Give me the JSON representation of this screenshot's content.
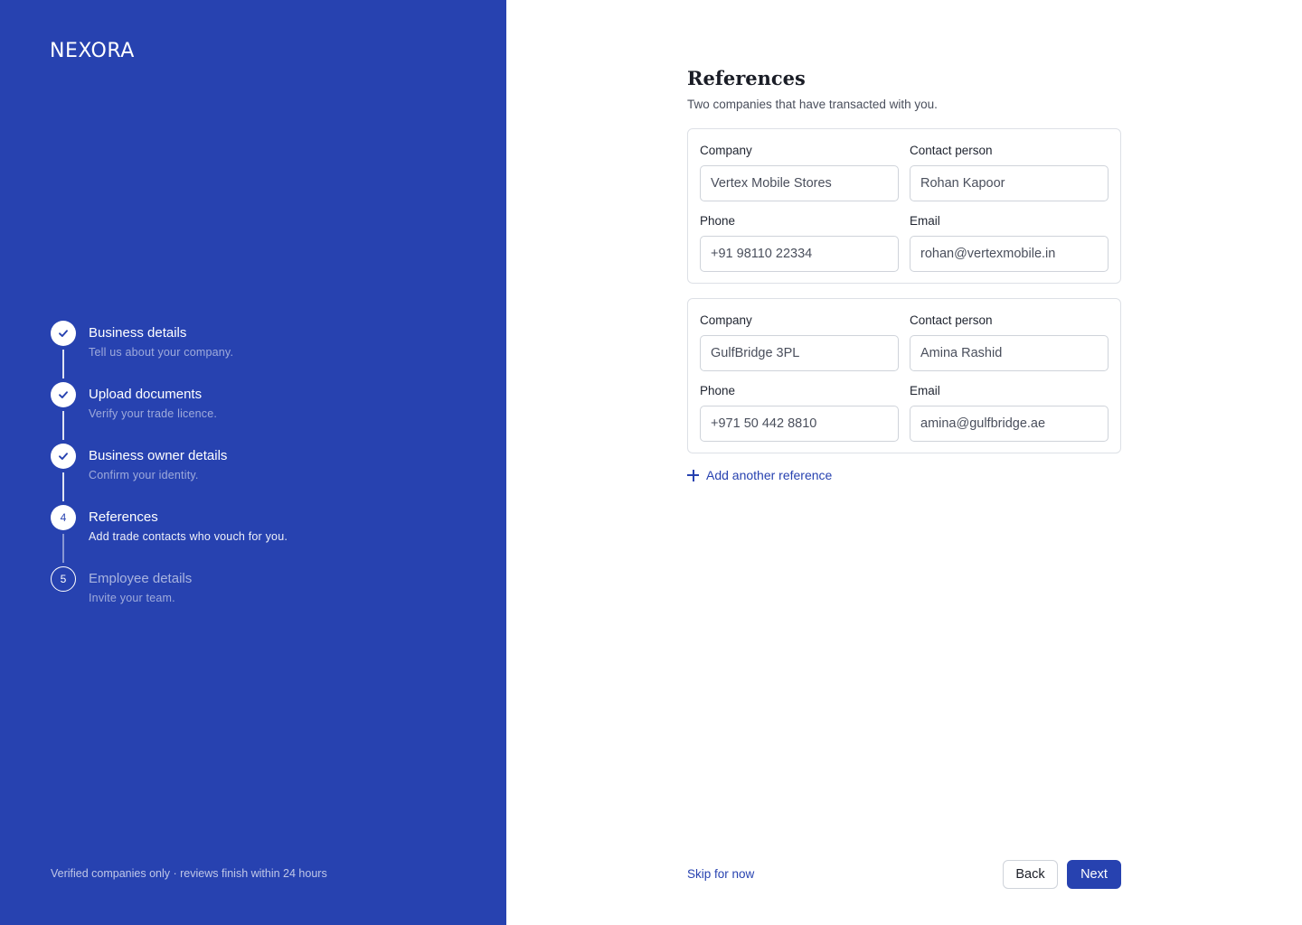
{
  "brand": {
    "logo": "NEXORA",
    "footer": "Verified companies only · reviews finish within 24 hours",
    "accent_color": "#2742b0"
  },
  "steps": [
    {
      "number": "1",
      "title": "Business details",
      "description": "Tell us about your company.",
      "status": "done",
      "icon": "check-icon"
    },
    {
      "number": "2",
      "title": "Upload documents",
      "description": "Verify your trade licence.",
      "status": "done",
      "icon": "check-icon"
    },
    {
      "number": "3",
      "title": "Business owner details",
      "description": "Confirm your identity.",
      "status": "done",
      "icon": "check-icon"
    },
    {
      "number": "4",
      "title": "References",
      "description": "Add trade contacts who vouch for you.",
      "status": "current"
    },
    {
      "number": "5",
      "title": "Employee details",
      "description": "Invite your team.",
      "status": "upcoming"
    }
  ],
  "main": {
    "title": "References",
    "subtitle": "Two companies that have transacted with you.",
    "references": [
      {
        "company_label": "Company",
        "company": "Vertex Mobile Stores",
        "contact_label": "Contact person",
        "contact": "Rohan Kapoor",
        "phone_label": "Phone",
        "phone": "+91 98110 22334",
        "email_label": "Email",
        "email": "rohan@vertexmobile.in"
      },
      {
        "company_label": "Company",
        "company": "GulfBridge 3PL",
        "contact_label": "Contact person",
        "contact": "Amina Rashid",
        "phone_label": "Phone",
        "phone": "+971 50 442 8810",
        "email_label": "Email",
        "email": "amina@gulfbridge.ae"
      }
    ],
    "add_reference_label": "Add another reference",
    "add_reference_icon": "plus-icon"
  },
  "footer": {
    "skip_label": "Skip for now",
    "back_label": "Back",
    "next_label": "Next"
  }
}
